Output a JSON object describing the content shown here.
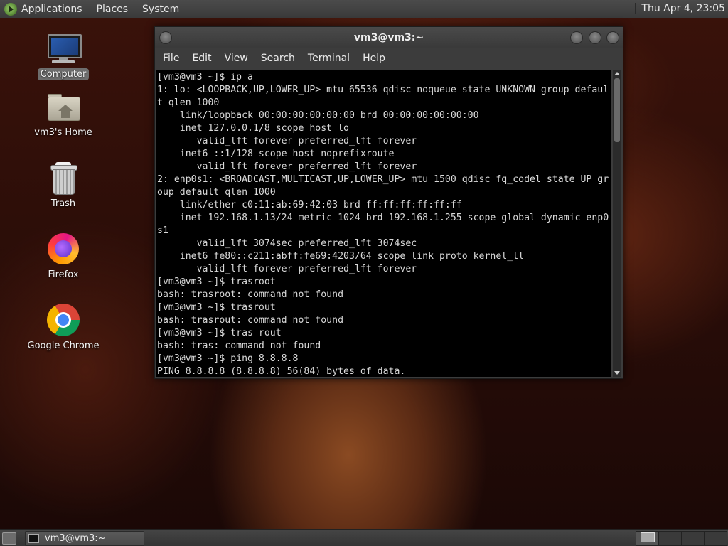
{
  "top_panel": {
    "menus": [
      "Applications",
      "Places",
      "System"
    ],
    "clock": "Thu Apr  4, 23:05"
  },
  "desktop_icons": [
    {
      "label": "Computer",
      "icon": "computer-icon"
    },
    {
      "label": "vm3's Home",
      "icon": "home-folder-icon"
    },
    {
      "label": "Trash",
      "icon": "trash-icon"
    },
    {
      "label": "Firefox",
      "icon": "firefox-icon"
    },
    {
      "label": "Google Chrome",
      "icon": "chrome-icon"
    }
  ],
  "terminal": {
    "title": "vm3@vm3:~",
    "menu": [
      "File",
      "Edit",
      "View",
      "Search",
      "Terminal",
      "Help"
    ],
    "output": "[vm3@vm3 ~]$ ip a\n1: lo: <LOOPBACK,UP,LOWER_UP> mtu 65536 qdisc noqueue state UNKNOWN group defaul\nt qlen 1000\n    link/loopback 00:00:00:00:00:00 brd 00:00:00:00:00:00\n    inet 127.0.0.1/8 scope host lo\n       valid_lft forever preferred_lft forever\n    inet6 ::1/128 scope host noprefixroute\n       valid_lft forever preferred_lft forever\n2: enp0s1: <BROADCAST,MULTICAST,UP,LOWER_UP> mtu 1500 qdisc fq_codel state UP gr\noup default qlen 1000\n    link/ether c0:11:ab:69:42:03 brd ff:ff:ff:ff:ff:ff\n    inet 192.168.1.13/24 metric 1024 brd 192.168.1.255 scope global dynamic enp0\ns1\n       valid_lft 3074sec preferred_lft 3074sec\n    inet6 fe80::c211:abff:fe69:4203/64 scope link proto kernel_ll\n       valid_lft forever preferred_lft forever\n[vm3@vm3 ~]$ trasroot\nbash: trasroot: command not found\n[vm3@vm3 ~]$ trasrout\nbash: trasrout: command not found\n[vm3@vm3 ~]$ tras rout\nbash: tras: command not found\n[vm3@vm3 ~]$ ping 8.8.8.8\nPING 8.8.8.8 (8.8.8.8) 56(84) bytes of data."
  },
  "bottom_panel": {
    "task_label": "vm3@vm3:~"
  }
}
